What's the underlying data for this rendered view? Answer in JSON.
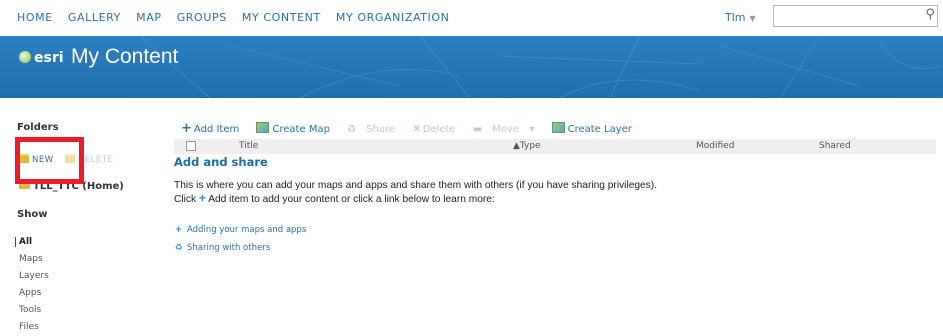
{
  "nav": {
    "items": [
      "HOME",
      "GALLERY",
      "MAP",
      "GROUPS",
      "MY CONTENT",
      "MY ORGANIZATION"
    ],
    "user": "Tlm",
    "search_placeholder": ""
  },
  "banner": {
    "logo": "esri",
    "title": "My Content"
  },
  "sidebar": {
    "folders_heading": "Folders",
    "new_label": "NEW",
    "delete_label": "DELETE",
    "home_folder": "TLL_TTC (Home)",
    "show_heading": "Show",
    "show_items": [
      "All",
      "Maps",
      "Layers",
      "Apps",
      "Tools",
      "Files"
    ]
  },
  "toolbar": {
    "add_item": "Add Item",
    "create_map": "Create Map",
    "share": "Share",
    "delete": "Delete",
    "move": "Move",
    "create_layer": "Create Layer"
  },
  "table": {
    "columns": [
      "Title",
      "Type",
      "Modified",
      "Shared"
    ]
  },
  "content": {
    "heading": "Add and share",
    "line1": "This is where you can add your maps and apps and share them with others (if you have sharing privileges).",
    "line2_pre": "Click",
    "line2_post": "Add item to add your content or click a link below to learn more:",
    "link1": "Adding your maps and apps",
    "link2": "Sharing with others"
  },
  "colors": {
    "banner": "#2176b8",
    "link": "#2b6fa8",
    "highlight": "#ee1c2b"
  }
}
